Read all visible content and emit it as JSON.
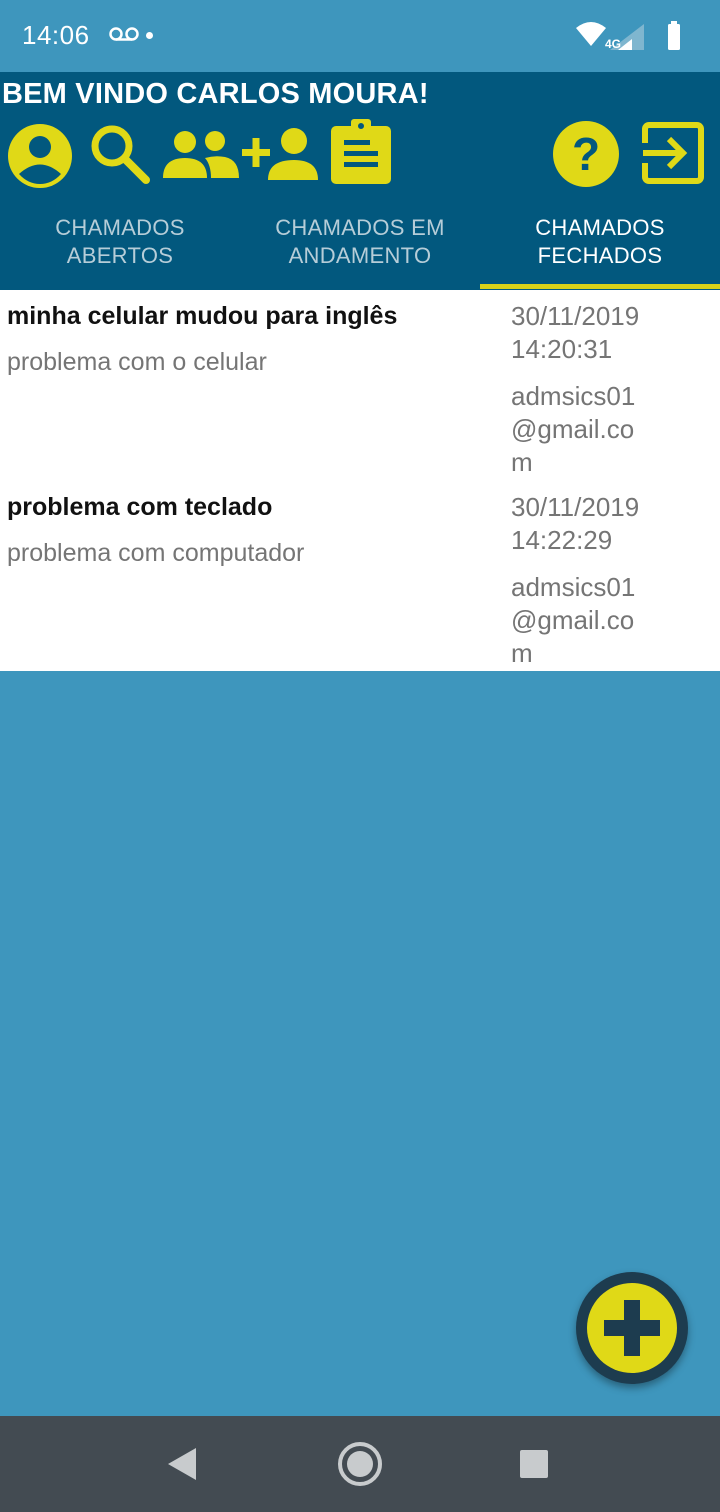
{
  "status_bar": {
    "time": "14:06",
    "network_label": "4G",
    "icons": [
      "voicemail-icon",
      "wifi-icon",
      "signal-icon",
      "battery-icon"
    ]
  },
  "header": {
    "welcome": "BEM VINDO CARLOS MOURA!",
    "colors": {
      "background": "#02587e",
      "accent": "#e0d917"
    },
    "toolbar_icons": [
      "account-icon",
      "search-icon",
      "group-icon",
      "add-person-icon",
      "clipboard-icon",
      "help-icon",
      "logout-icon"
    ]
  },
  "tabs": [
    {
      "label": "CHAMADOS ABERTOS",
      "active": false
    },
    {
      "label": "CHAMADOS EM ANDAMENTO",
      "active": false
    },
    {
      "label": "CHAMADOS FECHADOS",
      "active": true
    }
  ],
  "tickets": [
    {
      "title": "minha celular mudou para inglês",
      "subtitle": "problema com o celular",
      "date": "30/11/2019 14:20:31",
      "email": "admsics01@gmail.com"
    },
    {
      "title": "problema com teclado",
      "subtitle": "problema com computador",
      "date": "30/11/2019 14:22:29",
      "email": "admsics01@gmail.com"
    }
  ],
  "fab": {
    "icon": "add-icon"
  },
  "nav_bar": {
    "icons": [
      "back-icon",
      "home-icon",
      "recents-icon"
    ]
  }
}
